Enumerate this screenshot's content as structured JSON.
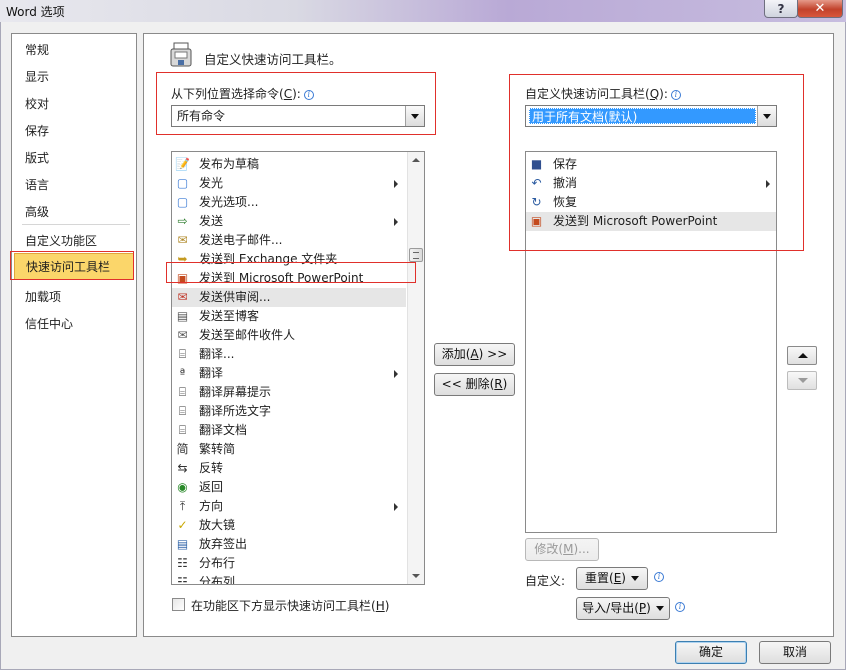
{
  "window": {
    "title": "Word 选项",
    "help_label": "?",
    "close_label": "✕"
  },
  "nav": {
    "items": [
      {
        "label": "常规"
      },
      {
        "label": "显示"
      },
      {
        "label": "校对"
      },
      {
        "label": "保存"
      },
      {
        "label": "版式"
      },
      {
        "label": "语言"
      },
      {
        "label": "高级"
      },
      {
        "label": "自定义功能区"
      },
      {
        "label": "快速访问工具栏",
        "active": true
      },
      {
        "label": "加载项"
      },
      {
        "label": "信任中心"
      }
    ]
  },
  "header": {
    "title": "自定义快速访问工具栏。",
    "icon": "qat-save-icon"
  },
  "left": {
    "choose_label": "从下列位置选择命令",
    "choose_key": "C",
    "choose_suffix": "):",
    "choose_value": "所有命令",
    "commands": [
      {
        "label": "发布为草稿",
        "icon": "publish-draft-icon"
      },
      {
        "label": "发光",
        "icon": "glow-icon",
        "submenu": true
      },
      {
        "label": "发光选项...",
        "icon": "glow-options-icon"
      },
      {
        "label": "发送",
        "icon": "send-icon",
        "submenu": true
      },
      {
        "label": "发送电子邮件...",
        "icon": "email-icon"
      },
      {
        "label": "发送到 Exchange 文件夹",
        "icon": "exchange-folder-icon"
      },
      {
        "label": "发送到 Microsoft PowerPoint",
        "icon": "powerpoint-icon"
      },
      {
        "label": "发送供审阅...",
        "icon": "send-review-icon",
        "highlight": true
      },
      {
        "label": "发送至博客",
        "icon": "blog-icon"
      },
      {
        "label": "发送至邮件收件人",
        "icon": "mail-recipient-icon"
      },
      {
        "label": "翻译...",
        "icon": "translate-icon"
      },
      {
        "label": "翻译",
        "icon": "translate-a-icon",
        "submenu": true
      },
      {
        "label": "翻译屏幕提示",
        "icon": "translate-tip-icon"
      },
      {
        "label": "翻译所选文字",
        "icon": "translate-selection-icon"
      },
      {
        "label": "翻译文档",
        "icon": "translate-doc-icon"
      },
      {
        "label": "繁转简",
        "icon": "trad-to-simp-icon"
      },
      {
        "label": "反转",
        "icon": "reverse-icon"
      },
      {
        "label": "返回",
        "icon": "back-icon"
      },
      {
        "label": "方向",
        "icon": "direction-icon",
        "submenu": true
      },
      {
        "label": "放大镜",
        "icon": "magnifier-icon"
      },
      {
        "label": "放弃签出",
        "icon": "discard-checkout-icon"
      },
      {
        "label": "分布行",
        "icon": "distribute-rows-icon"
      },
      {
        "label": "分布列",
        "icon": "distribute-cols-icon"
      }
    ]
  },
  "right": {
    "customize_label": "自定义快速访问工具栏",
    "customize_key": "Q",
    "customize_suffix": "):",
    "scope_value": "用于所有文档(默认)",
    "commands": [
      {
        "label": "保存",
        "icon": "save-icon"
      },
      {
        "label": "撤消",
        "icon": "undo-icon",
        "submenu": true
      },
      {
        "label": "恢复",
        "icon": "redo-icon"
      },
      {
        "label": "发送到 Microsoft PowerPoint",
        "icon": "powerpoint-icon",
        "highlight": true
      }
    ]
  },
  "actions": {
    "add_prefix": "添加(",
    "add_key": "A",
    "add_suffix": ") >>",
    "remove_prefix": "<< 删除(",
    "remove_key": "R",
    "remove_suffix": ")",
    "modify_prefix": "修改(",
    "modify_key": "M",
    "modify_suffix": ")...",
    "customize_label": "自定义:",
    "reset_prefix": "重置(",
    "reset_key": "E",
    "reset_suffix": ")",
    "import_prefix": "导入/导出(",
    "import_key": "P",
    "import_suffix": ")",
    "show_below_prefix": "在功能区下方显示快速访问工具栏(",
    "show_below_key": "H",
    "show_below_suffix": ")",
    "show_below_checked": false
  },
  "footer": {
    "ok_label": "确定",
    "cancel_label": "取消"
  }
}
